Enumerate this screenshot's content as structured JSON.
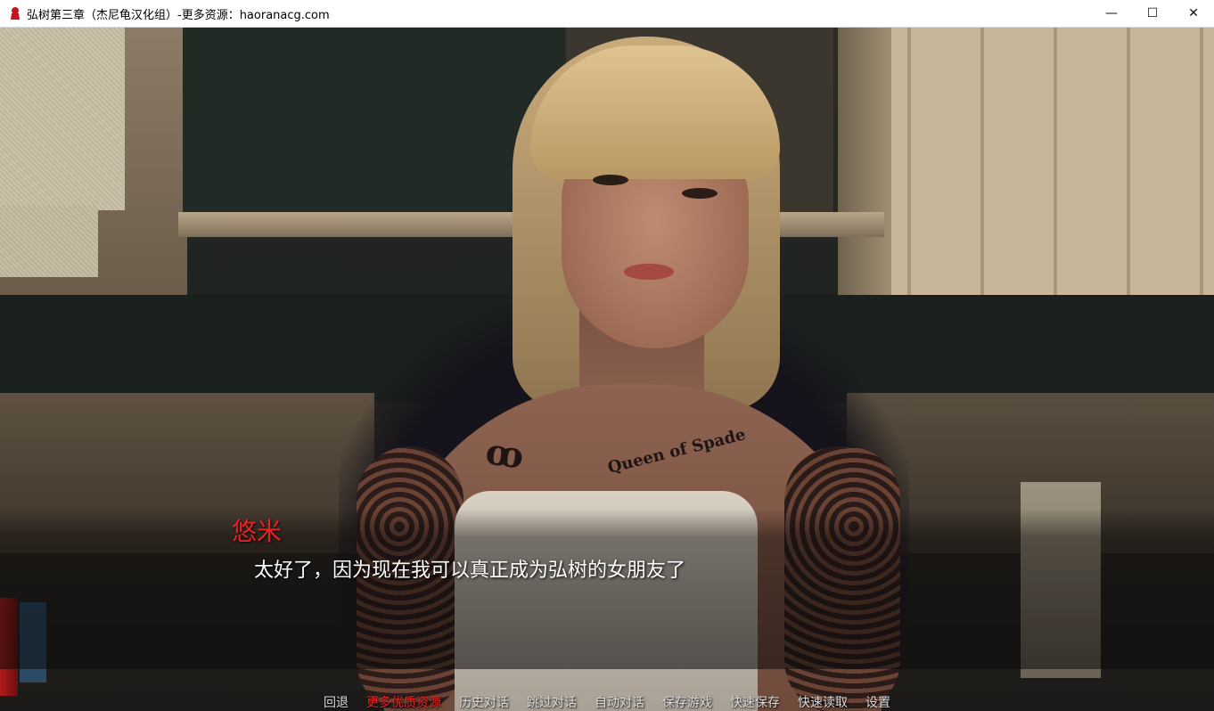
{
  "window": {
    "title": "弘树第三章（杰尼龟汉化组）-更多资源：haoranacg.com",
    "controls": {
      "minimize": "—",
      "maximize": "☐",
      "close": "✕"
    }
  },
  "dialogue": {
    "speaker": "悠米",
    "speaker_color": "#e52323",
    "text": "太好了，因为现在我可以真正成为弘树的女朋友了"
  },
  "tattoo": {
    "chest_text": "Queen of Spade"
  },
  "quick_menu": {
    "items": [
      {
        "label": "回退"
      },
      {
        "label": "更多优质资源",
        "highlight": true
      },
      {
        "label": "历史对话"
      },
      {
        "label": "跳过对话"
      },
      {
        "label": "自动对话"
      },
      {
        "label": "保存游戏"
      },
      {
        "label": "快速保存"
      },
      {
        "label": "快速读取"
      },
      {
        "label": "设置"
      }
    ],
    "highlight_color": "#e52323"
  }
}
